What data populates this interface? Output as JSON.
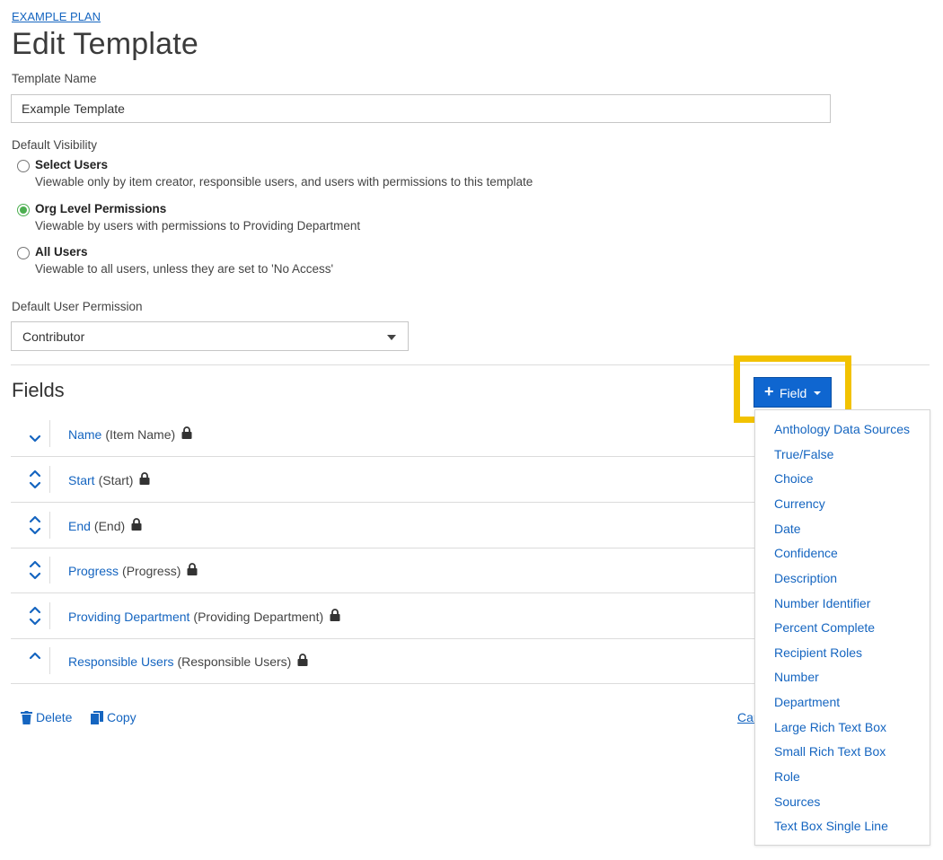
{
  "breadcrumb": "EXAMPLE PLAN",
  "page_title": "Edit Template",
  "template_name": {
    "label": "Template Name",
    "value": "Example Template"
  },
  "visibility": {
    "label": "Default Visibility",
    "options": [
      {
        "title": "Select Users",
        "desc": "Viewable only by item creator, responsible users, and users with permissions to this template",
        "checked": false
      },
      {
        "title": "Org Level Permissions",
        "desc": "Viewable by users with permissions to Providing Department",
        "checked": true
      },
      {
        "title": "All Users",
        "desc": "Viewable to all users, unless they are set to 'No Access'",
        "checked": false
      }
    ]
  },
  "permission": {
    "label": "Default User Permission",
    "value": "Contributor"
  },
  "fields": {
    "title": "Fields",
    "add_button": "Field",
    "rows": [
      {
        "name": "Name",
        "paren": "(Item Name)",
        "control": "chevron-down-icon"
      },
      {
        "name": "Start",
        "paren": "(Start)",
        "control": "reorder-icon"
      },
      {
        "name": "End",
        "paren": "(End)",
        "control": "reorder-icon"
      },
      {
        "name": "Progress",
        "paren": "(Progress)",
        "control": "reorder-icon"
      },
      {
        "name": "Providing Department",
        "paren": "(Providing Department)",
        "control": "reorder-icon"
      },
      {
        "name": "Responsible Users",
        "paren": "(Responsible Users)",
        "control": "chevron-up-icon"
      }
    ]
  },
  "actions": {
    "delete": "Delete",
    "copy": "Copy",
    "cancel": "Cancel"
  },
  "field_menu": [
    "Anthology Data Sources",
    "True/False",
    "Choice",
    "Currency",
    "Date",
    "Confidence",
    "Description",
    "Number Identifier",
    "Percent Complete",
    "Recipient Roles",
    "Number",
    "Department",
    "Large Rich Text Box",
    "Small Rich Text Box",
    "Role",
    "Sources",
    "Text Box Single Line"
  ],
  "colors": {
    "link": "#1565c0",
    "button": "#0f66d0",
    "highlight": "#f2c200",
    "radio_checked": "#4caf50"
  }
}
